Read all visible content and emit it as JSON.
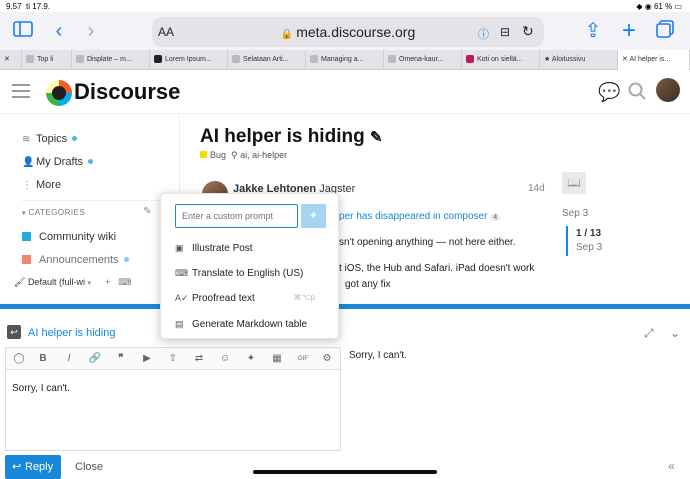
{
  "status_bar": {
    "time": "9.57",
    "date": "ti 17.9.",
    "battery": "61 %"
  },
  "browser": {
    "text_size_label": "AA",
    "url": "meta.discourse.org",
    "tabs": [
      "Top li",
      "Displate – m...",
      "Lorem Ipsum...",
      "Selataan Arti...",
      "Managing a...",
      "Omena-kaur...",
      "Koti on siellä...",
      "Aloitussivu",
      "AI helper is..."
    ]
  },
  "header": {
    "logo_text": "Discourse"
  },
  "sidebar": {
    "items": [
      {
        "label": "Topics",
        "icon": "layers-icon"
      },
      {
        "label": "My Drafts",
        "icon": "user-icon"
      },
      {
        "label": "More",
        "icon": "more-vertical-icon"
      }
    ],
    "categories_header": "CATEGORIES",
    "categories": [
      {
        "label": "Community wiki",
        "color": "#25aae1"
      },
      {
        "label": "Announcements",
        "color": "#e45735"
      }
    ],
    "footer_select": "Default (full-wi"
  },
  "topic": {
    "title": "AI helper is hiding",
    "category": "Bug",
    "category_color": "#f7dc06",
    "tags": "ai, ai-helper",
    "author_name": "Jakke Lehtonen",
    "author_handle": "Jagster",
    "date": "14d",
    "link_text": "per has disappeared in composer",
    "link_count": "4",
    "line1": "sn't opening anything — not here either.",
    "line2": "t iOS, the Hub and Safari. iPad doesn't work",
    "line3": "got any fix"
  },
  "timeline": {
    "start": "Sep 3",
    "position": "1 / 13",
    "end": "Sep 3"
  },
  "composer": {
    "reply_title": "AI helper is hiding",
    "editor_text": "Sorry, I can't.",
    "preview_text": "Sorry, I can't.",
    "reply_button": "Reply",
    "close_button": "Close",
    "toolbar_gif": "GIF"
  },
  "ai_helper": {
    "prompt_placeholder": "Enter a custom prompt",
    "options": [
      {
        "label": "Illustrate Post",
        "icon": "image-icon",
        "shortcut": ""
      },
      {
        "label": "Translate to English (US)",
        "icon": "translate-icon",
        "shortcut": ""
      },
      {
        "label": "Proofread text",
        "icon": "spellcheck-icon",
        "shortcut": "⌘⌥p"
      },
      {
        "label": "Generate Markdown table",
        "icon": "table-icon",
        "shortcut": ""
      }
    ]
  }
}
